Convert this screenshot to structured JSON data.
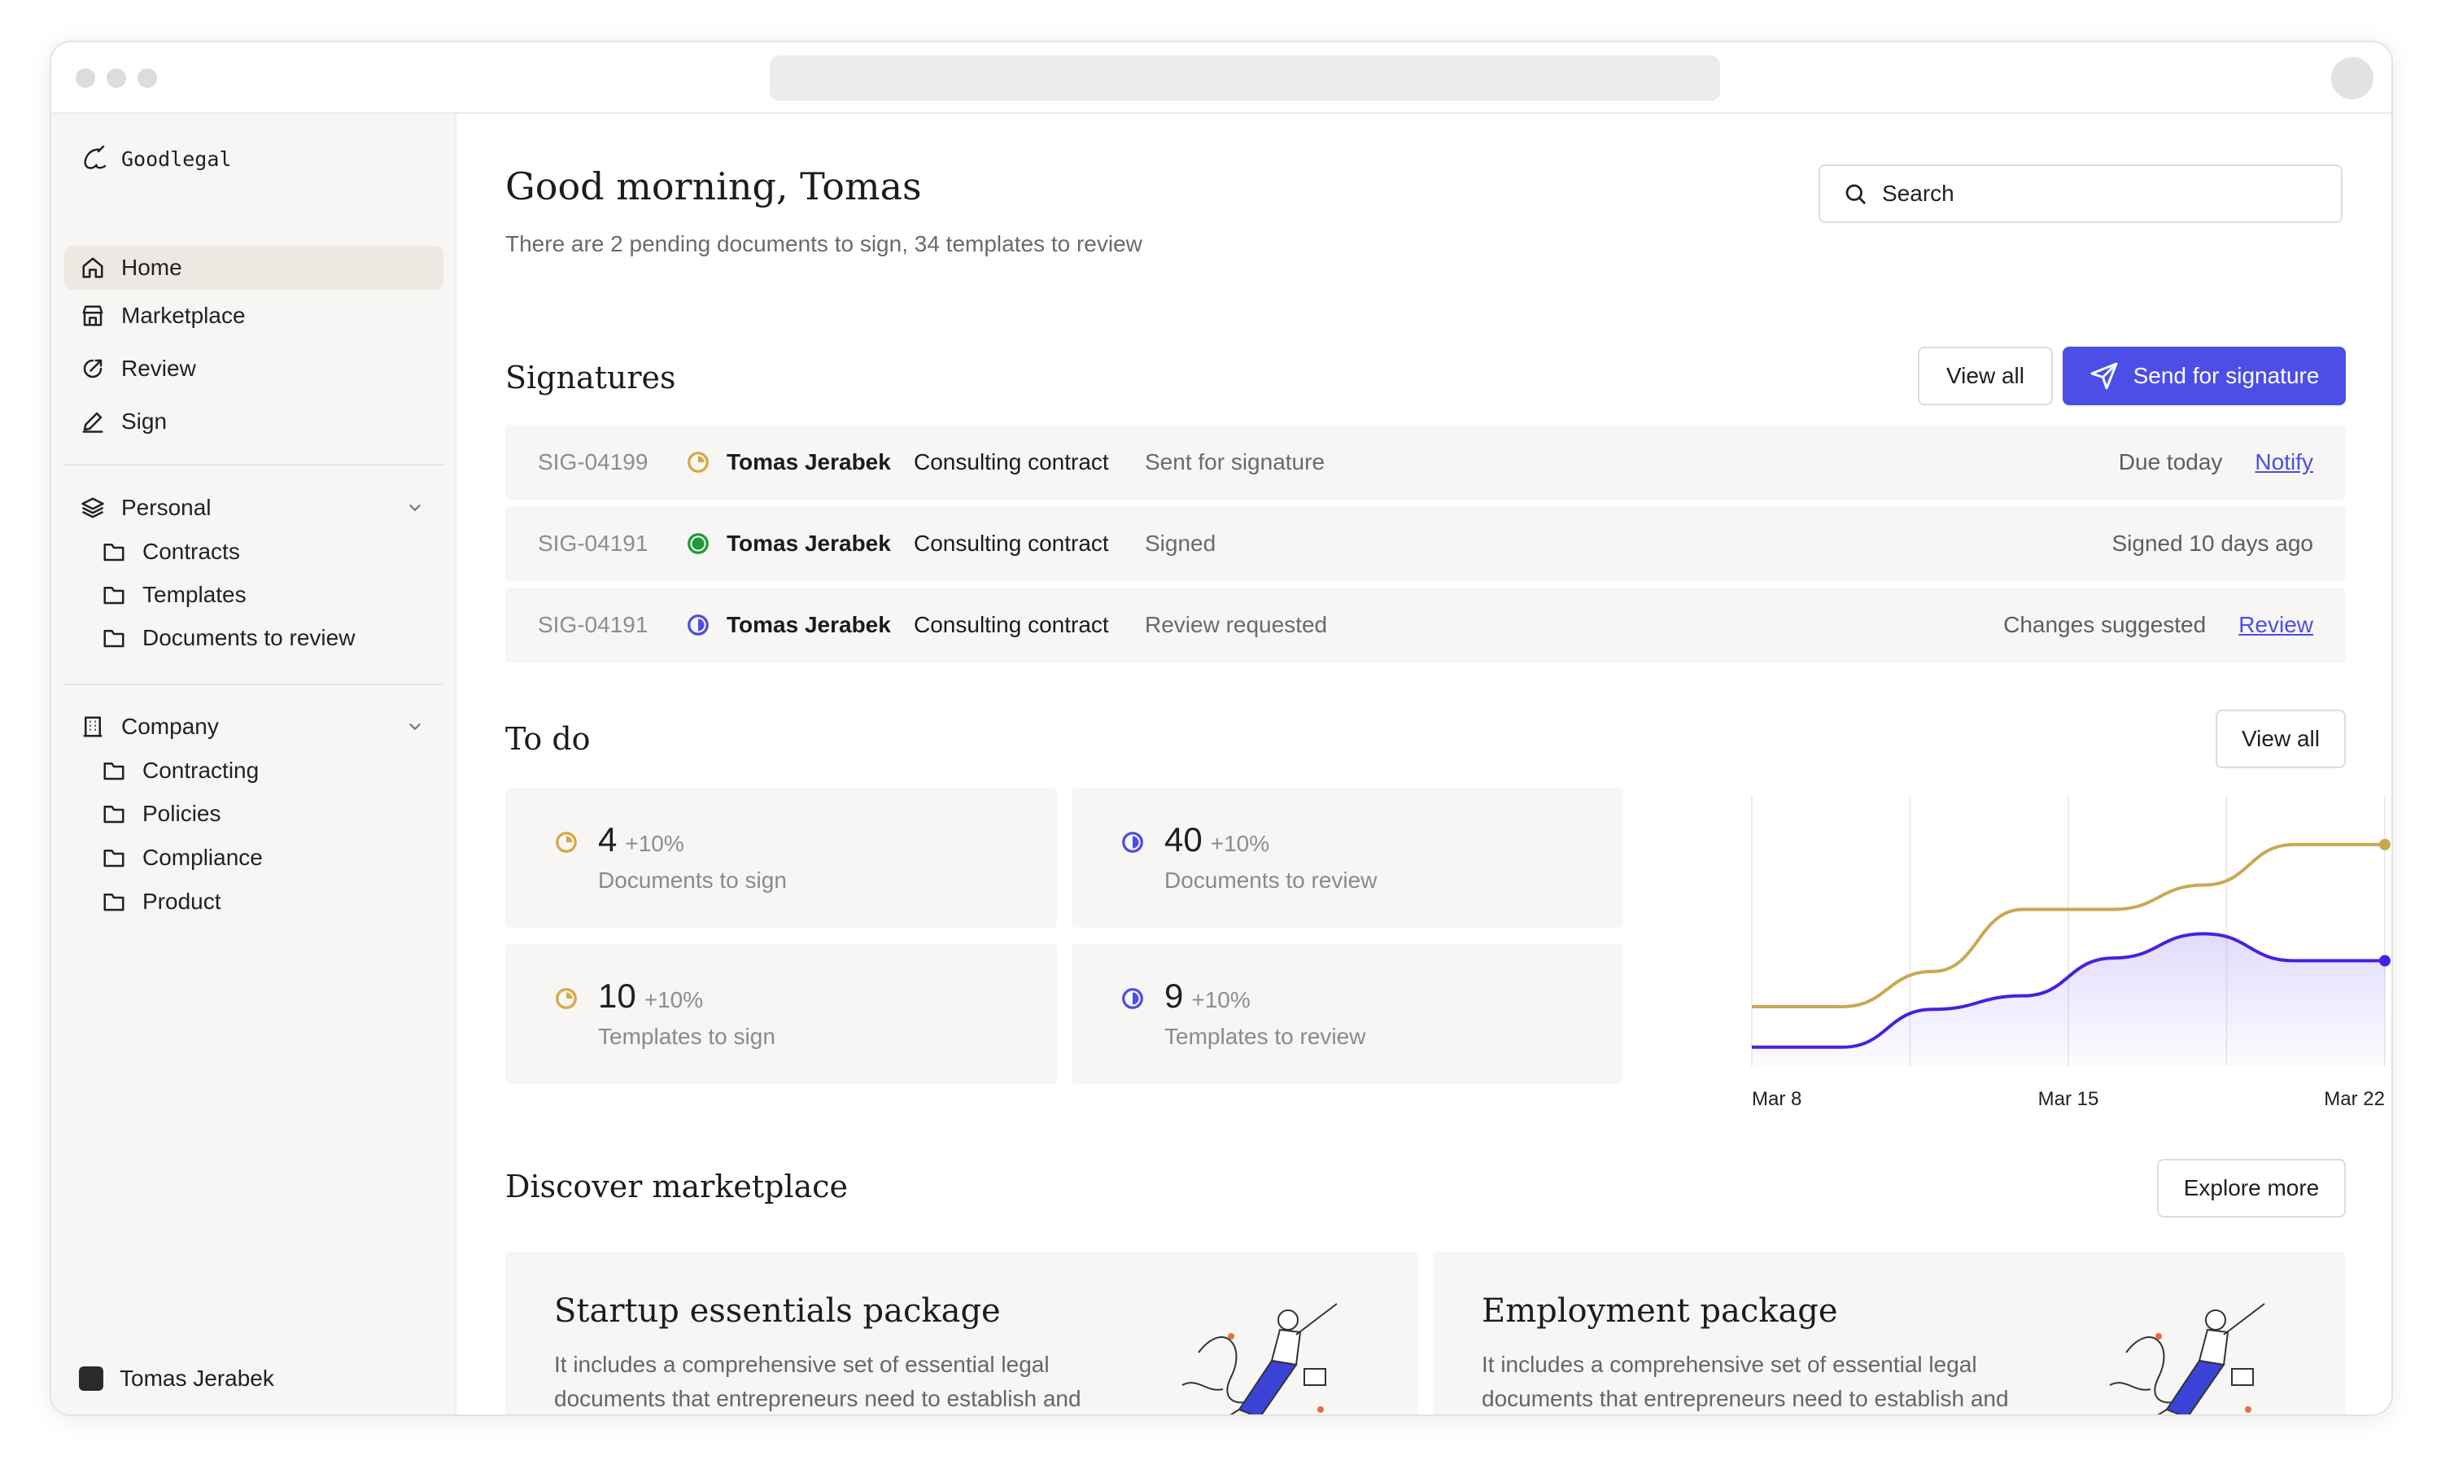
{
  "app": {
    "name": "Goodlegal"
  },
  "sidebar": {
    "nav": [
      {
        "label": "Home",
        "icon": "home-icon"
      },
      {
        "label": "Marketplace",
        "icon": "store-icon"
      },
      {
        "label": "Review",
        "icon": "edit-icon"
      },
      {
        "label": "Sign",
        "icon": "pen-icon"
      }
    ],
    "groups": [
      {
        "label": "Personal",
        "icon": "layers-icon",
        "items": [
          "Contracts",
          "Templates",
          "Documents to review"
        ]
      },
      {
        "label": "Company",
        "icon": "building-icon",
        "items": [
          "Contracting",
          "Policies",
          "Compliance",
          "Product"
        ]
      }
    ],
    "user": "Tomas Jerabek"
  },
  "header": {
    "greeting": "Good morning, Tomas",
    "subtitle": "There are 2 pending documents to sign, 34 templates to review",
    "search_placeholder": "Search"
  },
  "signatures": {
    "title": "Signatures",
    "view_all": "View all",
    "send_button": "Send for signature",
    "rows": [
      {
        "id": "SIG-04199",
        "status_color": "#d4a845",
        "name": "Tomas Jerabek",
        "doc": "Consulting contract",
        "status": "Sent for signature",
        "right_text": "Due today",
        "action": "Notify"
      },
      {
        "id": "SIG-04191",
        "status_color": "#1e9a3a",
        "name": "Tomas Jerabek",
        "doc": "Consulting contract",
        "status": "Signed",
        "right_text": "Signed 10 days ago",
        "action": ""
      },
      {
        "id": "SIG-04191",
        "status_color": "#4d4de8",
        "name": "Tomas Jerabek",
        "doc": "Consulting contract",
        "status": "Review requested",
        "right_text": "Changes suggested",
        "action": "Review"
      }
    ]
  },
  "todo": {
    "title": "To do",
    "view_all": "View all",
    "cards": [
      {
        "value": "4",
        "change": "+10%",
        "label": "Documents to sign",
        "color": "#d4a845"
      },
      {
        "value": "40",
        "change": "+10%",
        "label": "Documents to review",
        "color": "#4d4de8"
      },
      {
        "value": "10",
        "change": "+10%",
        "label": "Templates to sign",
        "color": "#d4a845"
      },
      {
        "value": "9",
        "change": "+10%",
        "label": "Templates to review",
        "color": "#4d4de8"
      }
    ]
  },
  "chart_data": {
    "type": "line",
    "x": [
      0,
      1,
      2,
      3,
      4,
      5,
      6,
      7
    ],
    "x_tick_labels": [
      "Mar 8",
      "Mar 15",
      "Mar 22"
    ],
    "x_tick_positions": [
      0,
      3.5,
      7
    ],
    "ylim": [
      0,
      100
    ],
    "grid": true,
    "series": [
      {
        "color": "#c9a851",
        "values": [
          22,
          22,
          35,
          58,
          58,
          67,
          82,
          82
        ]
      },
      {
        "color": "#4a1fe0",
        "values": [
          7,
          7,
          21,
          26,
          40,
          49,
          39,
          39
        ],
        "fill": true
      }
    ]
  },
  "marketplace": {
    "title": "Discover marketplace",
    "explore": "Explore more",
    "cards": [
      {
        "title": "Startup essentials package",
        "desc": "It includes a comprehensive set of essential legal documents that entrepreneurs need to establish and protect their business."
      },
      {
        "title": "Employment package",
        "desc": "It includes a comprehensive set of essential legal documents that entrepreneurs need to establish and protect their business."
      }
    ]
  }
}
